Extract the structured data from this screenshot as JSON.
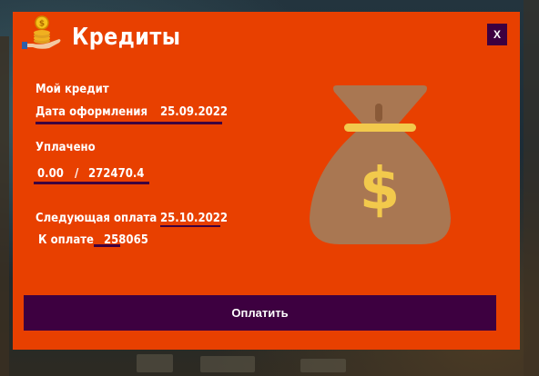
{
  "dialog": {
    "title": "Кредиты",
    "close_label": "X",
    "section_title": "Мой кредит",
    "issue_date_label": "Дата оформления",
    "issue_date_value": "25.09.2022",
    "paid_label": "Уплачено",
    "paid_value": "0.00",
    "paid_separator": "/",
    "total_value": "272470.4",
    "next_payment_label": "Следующая оплата",
    "next_payment_date": "25.10.2022",
    "due_label": "К оплате",
    "due_value": "258065",
    "pay_button_label": "Оплатить",
    "bag_symbol": "$"
  },
  "colors": {
    "panel_background": "#e84000",
    "accent_dark": "#3d0040",
    "bag": "#a97752",
    "dollar_sign": "#f2c94c",
    "text": "#ffffff"
  },
  "icons": {
    "header": "hand-with-coins-icon",
    "illustration": "money-bag-icon"
  }
}
